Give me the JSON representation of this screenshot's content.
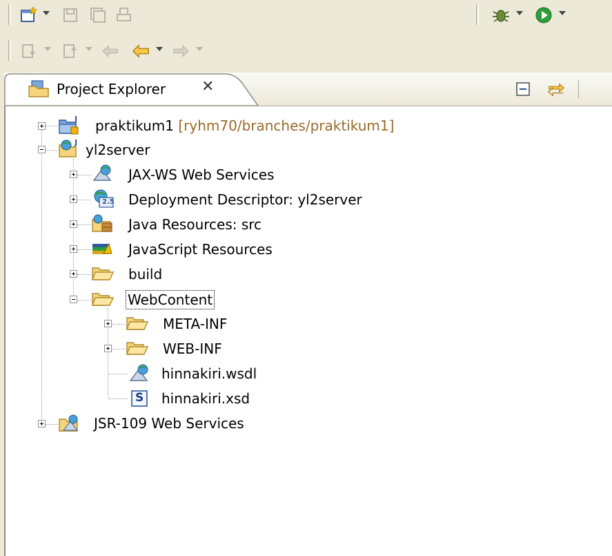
{
  "tabs": [
    {
      "label": "Project Explorer",
      "close_icon": "close-icon"
    }
  ],
  "tree": {
    "praktikum1": {
      "label": "praktikum1",
      "decoration": "[ryhm70/branches/praktikum1]"
    },
    "yl2server": {
      "label": "yl2server"
    },
    "jaxws": {
      "label": "JAX-WS Web Services"
    },
    "deploy": {
      "label": "Deployment Descriptor: yl2server",
      "badge": "2.5"
    },
    "javares": {
      "label": "Java Resources: src"
    },
    "jsres": {
      "label": "JavaScript Resources"
    },
    "build": {
      "label": "build"
    },
    "webcontent": {
      "label": "WebContent"
    },
    "metainf": {
      "label": "META-INF"
    },
    "webinf": {
      "label": "WEB-INF"
    },
    "wsdl": {
      "label": "hinnakiri.wsdl"
    },
    "xsd": {
      "label": "hinnakiri.xsd",
      "badge": "S"
    },
    "jsr109": {
      "label": "JSR-109 Web Services"
    }
  },
  "colors": {
    "background": "#ece9d8",
    "view": "#ffffff",
    "decoration": "#9a6a2a",
    "folder": "#f5d47a",
    "run": "#2f9e3a"
  }
}
